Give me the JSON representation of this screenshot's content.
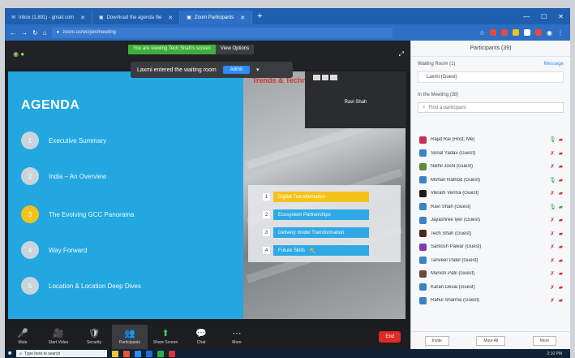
{
  "browser": {
    "tabs": [
      {
        "label": "Inbox (1,891) - gmail.com",
        "active": false
      },
      {
        "label": "Download the agenda file",
        "active": false
      },
      {
        "label": "Zoom Participants",
        "active": true
      }
    ],
    "url": "zoom.us/wc/join/meeting"
  },
  "meeting": {
    "share_status": "You are viewing Tech Shah's screen",
    "view_options": "View Options",
    "waiting_message": "Laxmi entered the waiting room",
    "admit_label": "Admit",
    "speaker_name": "Ravi Shah",
    "photo_caption": "Trends & Technologies"
  },
  "slide": {
    "title": "AGENDA",
    "items": [
      {
        "num": "1",
        "text": "Executive Summary",
        "highlight": false
      },
      {
        "num": "2",
        "text": "India – An Overview",
        "highlight": false
      },
      {
        "num": "3",
        "text": "The Evolving GCC Panorama",
        "highlight": true
      },
      {
        "num": "4",
        "text": "Way Forward",
        "highlight": false
      },
      {
        "num": "5",
        "text": "Location & Location Deep Dives",
        "highlight": false
      }
    ],
    "tags": [
      {
        "num": "1",
        "text": "Digital Transformation",
        "color": "#f5c21b"
      },
      {
        "num": "2",
        "text": "Ecosystem Partnerships",
        "color": "#2ea9e6"
      },
      {
        "num": "3",
        "text": "Delivery model Transformation",
        "color": "#2ea9e6"
      },
      {
        "num": "4",
        "text": "Future Skills",
        "color": "#2ea9e6"
      }
    ]
  },
  "toolbar": {
    "items": [
      {
        "icon": "🎤",
        "label": "Mute"
      },
      {
        "icon": "🎥",
        "label": "Start Video"
      },
      {
        "icon": "🛡",
        "label": "Security"
      },
      {
        "icon": "👥",
        "label": "Participants"
      },
      {
        "icon": "⬆",
        "label": "Share Screen"
      },
      {
        "icon": "💬",
        "label": "Chat"
      },
      {
        "icon": "⋯",
        "label": "More"
      }
    ],
    "end_label": "End"
  },
  "participants": {
    "title": "Participants (39)",
    "waiting_header": "Waiting Room (1)",
    "admit_all": "Message",
    "waiting_user": "Laxmi (Guest)",
    "in_meeting_header": "In the Meeting (38)",
    "search_placeholder": "Find a participant",
    "list": [
      {
        "name": "Rajat Rai (Host, Me)",
        "color": "#c2305a"
      },
      {
        "name": "Sonal Yadav (Guest)",
        "color": "#3b82c4"
      },
      {
        "name": "Nikhil Joshi (Guest)",
        "color": "#5b8c3a"
      },
      {
        "name": "Mohan Rathod (Guest)",
        "color": "#3b82c4"
      },
      {
        "name": "Vikram Verma (Guest)",
        "color": "#1c1c1c"
      },
      {
        "name": "Ravi Shah (Guest)",
        "color": "#3b82c4"
      },
      {
        "name": "Jayashree Iyer (Guest)",
        "color": "#3b82c4"
      },
      {
        "name": "Tech Shah (Guest)",
        "color": "#4a2a1a"
      },
      {
        "name": "Santosh Pawar (Guest)",
        "color": "#7a3ab0"
      },
      {
        "name": "Tanveer Patel (Guest)",
        "color": "#3b82c4"
      },
      {
        "name": "Manish Patil (Guest)",
        "color": "#6a4a3a"
      },
      {
        "name": "Karan Desai (Guest)",
        "color": "#3b82c4"
      },
      {
        "name": "Rahul Sharma (Guest)",
        "color": "#3b82c4"
      }
    ],
    "footer": [
      "Invite",
      "Mute All",
      "More"
    ]
  },
  "taskbar": {
    "search_placeholder": "Type here to search",
    "time": "2:10 PM"
  }
}
